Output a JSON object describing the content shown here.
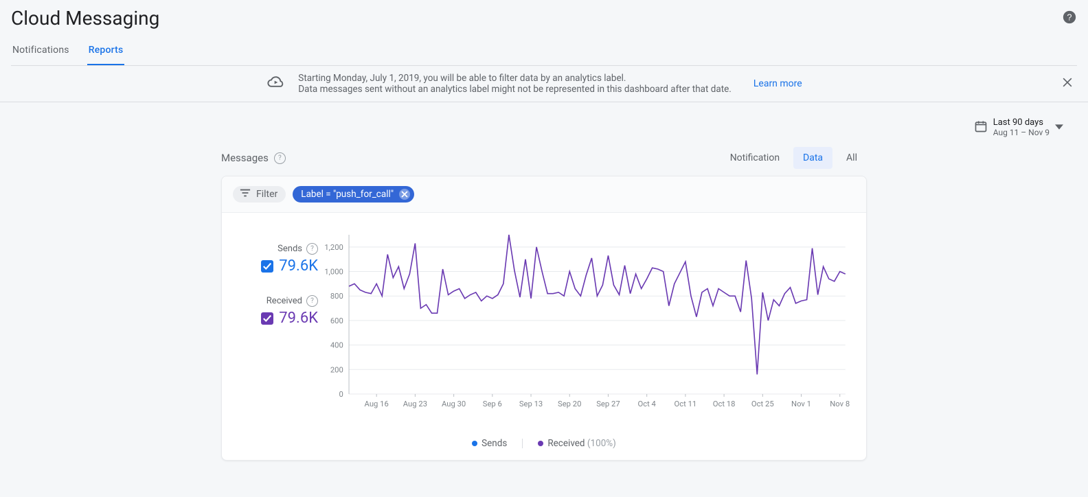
{
  "page_title": "Cloud Messaging",
  "tabs": {
    "notifications": "Notifications",
    "reports": "Reports",
    "active": "reports"
  },
  "banner": {
    "line1": "Starting Monday, July 1, 2019, you will be able to filter data by an analytics label.",
    "line2": "Data messages sent without an analytics label might not be represented in this dashboard after that date.",
    "learn_more": "Learn more"
  },
  "date_picker": {
    "label": "Last 90 days",
    "range": "Aug 11 – Nov 9"
  },
  "section": {
    "title": "Messages",
    "tabs": {
      "notification": "Notification",
      "data": "Data",
      "all": "All",
      "active": "data"
    }
  },
  "filter": {
    "filter_label": "Filter",
    "active_chip": "Label = \"push_for_call\""
  },
  "metrics": {
    "sends": {
      "label": "Sends",
      "value": "79.6K",
      "checked": true
    },
    "received": {
      "label": "Received",
      "value": "79.6K",
      "checked": true
    }
  },
  "bottom_legend": {
    "sends": "Sends",
    "received": "Received",
    "received_pct": "(100%)"
  },
  "chart_data": {
    "type": "line",
    "title": "",
    "xlabel": "",
    "ylabel": "",
    "ylim": [
      0,
      1300
    ],
    "yticks": [
      0,
      200,
      400,
      600,
      800,
      1000,
      1200
    ],
    "x_tick_labels": [
      "Aug 16",
      "Aug 23",
      "Aug 30",
      "Sep 6",
      "Sep 13",
      "Sep 20",
      "Sep 27",
      "Oct 4",
      "Oct 11",
      "Oct 18",
      "Oct 25",
      "Nov 1",
      "Nov 8"
    ],
    "x_start": "Aug 11",
    "x_end": "Nov 9",
    "series": [
      {
        "name": "Sends",
        "color": "#1a73e8",
        "values": [
          880,
          900,
          850,
          830,
          820,
          900,
          800,
          1140,
          950,
          1040,
          860,
          980,
          1230,
          700,
          730,
          660,
          660,
          1020,
          810,
          840,
          860,
          780,
          810,
          830,
          760,
          800,
          780,
          810,
          900,
          1300,
          1010,
          790,
          1100,
          780,
          1200,
          1000,
          820,
          820,
          830,
          800,
          1000,
          860,
          800,
          970,
          1110,
          800,
          890,
          1130,
          890,
          810,
          1050,
          820,
          980,
          860,
          940,
          1030,
          1020,
          1000,
          720,
          900,
          990,
          1080,
          800,
          630,
          830,
          860,
          720,
          860,
          830,
          800,
          800,
          670,
          1090,
          780,
          160,
          830,
          600,
          770,
          720,
          820,
          870,
          740,
          760,
          770,
          1190,
          810,
          1040,
          940,
          920,
          1000,
          980
        ]
      },
      {
        "name": "Received",
        "color": "#6a3ab2",
        "values": [
          880,
          900,
          850,
          830,
          820,
          900,
          800,
          1140,
          950,
          1040,
          860,
          980,
          1230,
          700,
          730,
          660,
          660,
          1020,
          810,
          840,
          860,
          780,
          810,
          830,
          760,
          800,
          780,
          810,
          900,
          1300,
          1010,
          790,
          1100,
          780,
          1200,
          1000,
          820,
          820,
          830,
          800,
          1000,
          860,
          800,
          970,
          1110,
          800,
          890,
          1130,
          890,
          810,
          1050,
          820,
          980,
          860,
          940,
          1030,
          1020,
          1000,
          720,
          900,
          990,
          1080,
          800,
          630,
          830,
          860,
          720,
          860,
          830,
          800,
          800,
          670,
          1090,
          780,
          160,
          830,
          600,
          770,
          720,
          820,
          870,
          740,
          760,
          770,
          1190,
          810,
          1040,
          940,
          920,
          1000,
          980
        ]
      }
    ]
  }
}
